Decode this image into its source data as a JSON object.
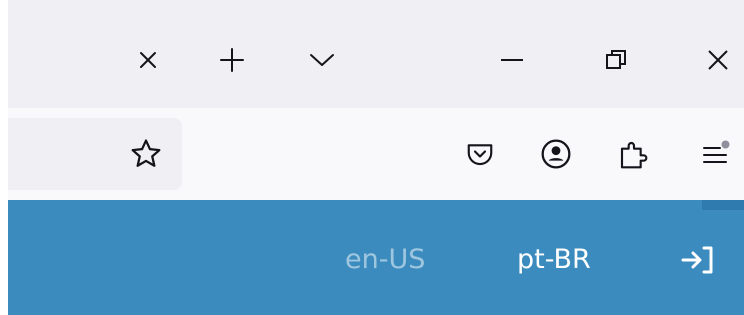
{
  "titlebar": {
    "controls": [
      {
        "icon": "close-tab-icon"
      },
      {
        "icon": "new-tab-icon"
      },
      {
        "icon": "list-all-tabs-icon"
      },
      {
        "icon": "minimize-icon"
      },
      {
        "icon": "restore-icon"
      },
      {
        "icon": "close-window-icon"
      }
    ]
  },
  "toolbar": {
    "icons": [
      "bookmark-star-icon",
      "pocket-icon",
      "account-icon",
      "extensions-icon",
      "app-menu-icon"
    ]
  },
  "page": {
    "languages": [
      {
        "label": "en-US",
        "active": false
      },
      {
        "label": "pt-BR",
        "active": true
      }
    ],
    "header_color": "#3b8bbe"
  }
}
